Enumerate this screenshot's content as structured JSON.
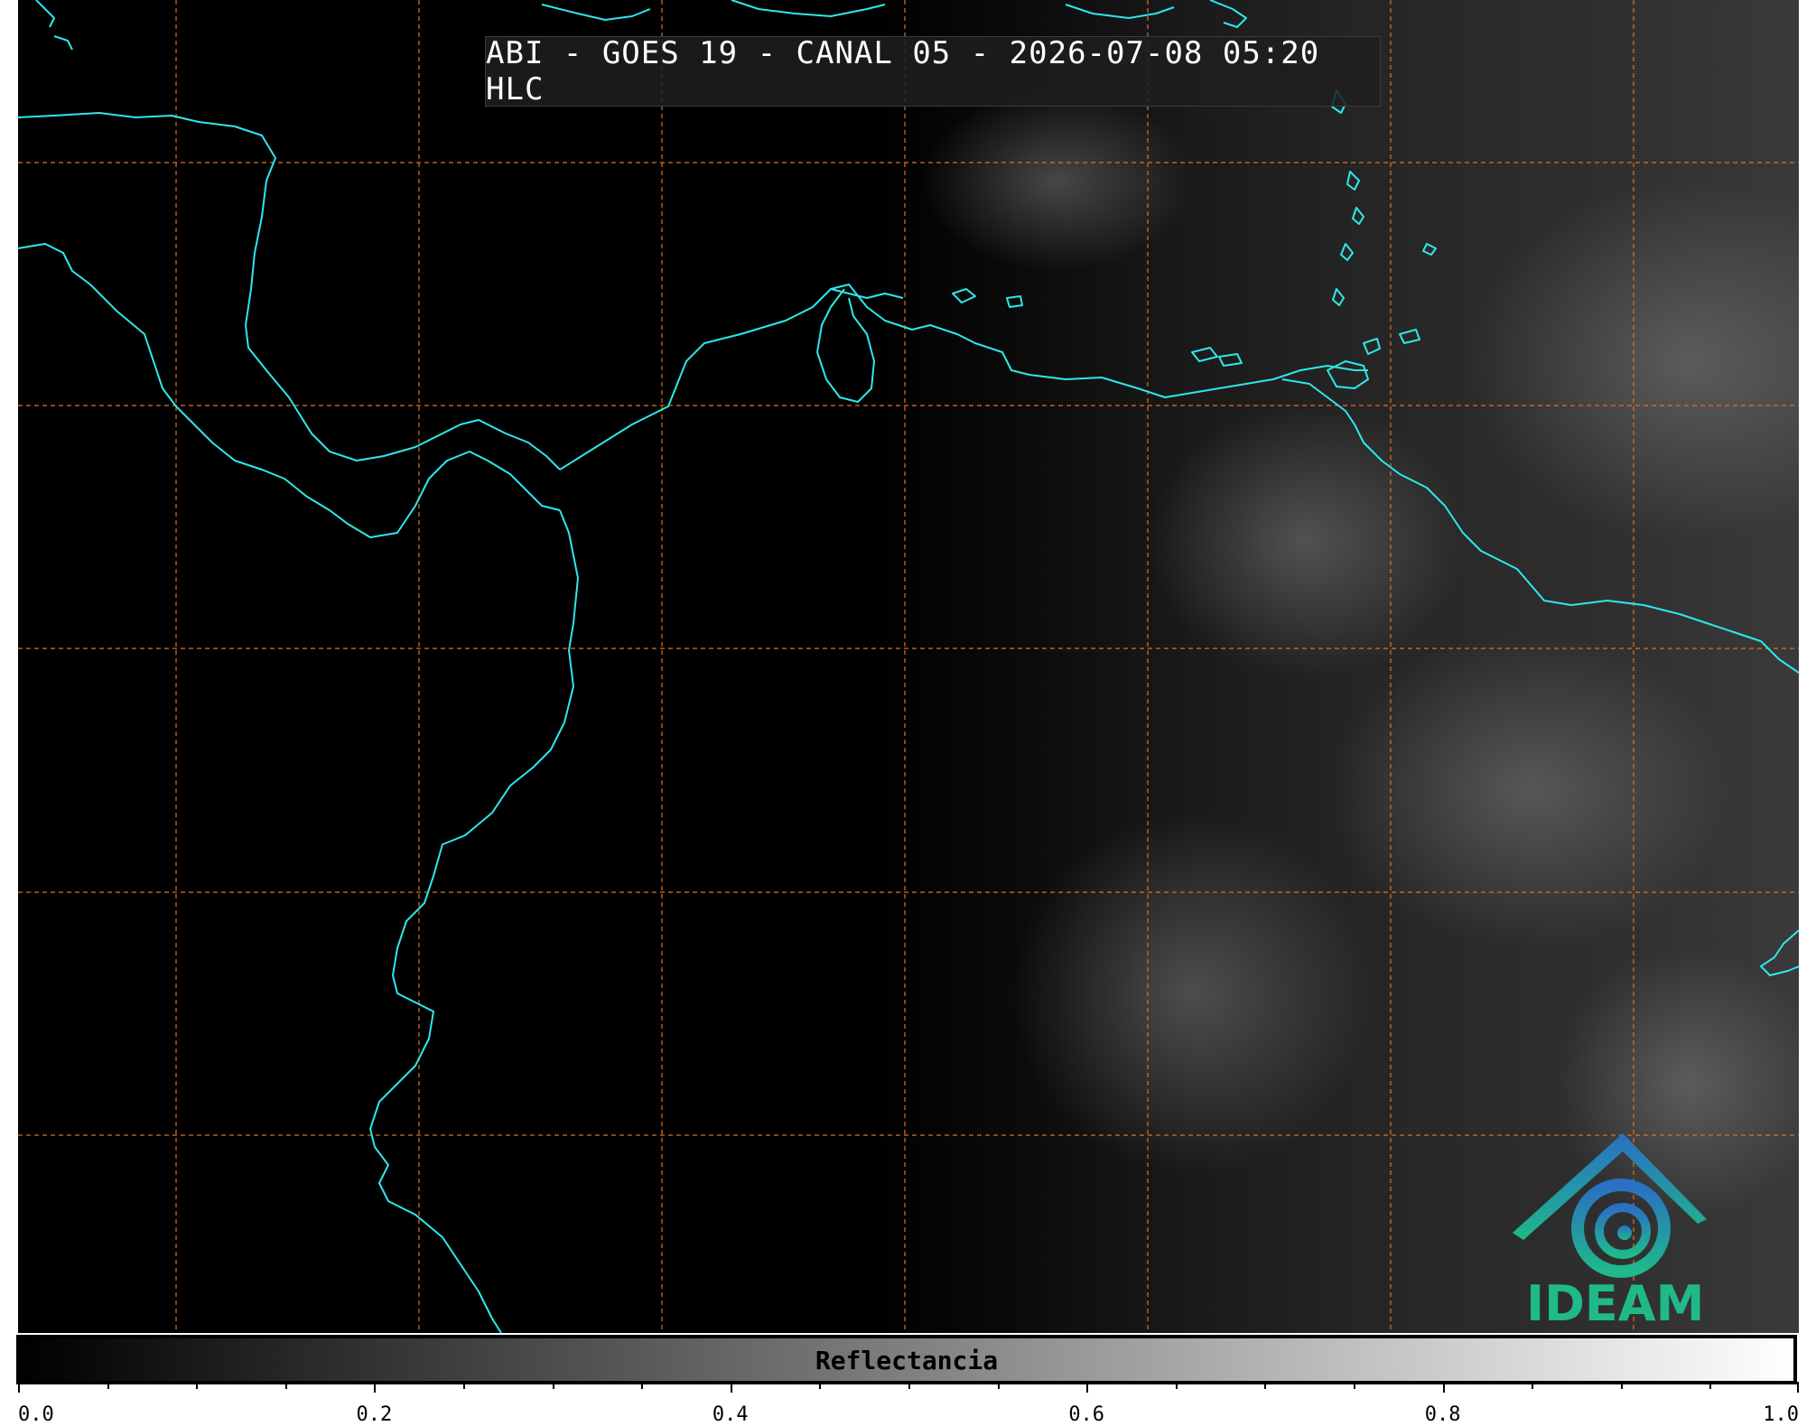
{
  "map": {
    "title": "ABI - GOES 19 - CANAL 05 - 2026-07-08 05:20 HLC",
    "graticule_color": "#e07020",
    "coastline_color": "#2ee8ea",
    "basemap": "grayscale satellite reflectance"
  },
  "logo": {
    "text": "IDEAM",
    "colors": [
      "#2a6fc4",
      "#1fb98a"
    ]
  },
  "colorbar": {
    "label": "Reflectancia",
    "min": 0.0,
    "max": 1.0,
    "colormap": "gray",
    "tick_labels": [
      "0.0",
      "0.2",
      "0.4",
      "0.6",
      "0.8",
      "1.0"
    ],
    "minor_step": 0.05
  }
}
